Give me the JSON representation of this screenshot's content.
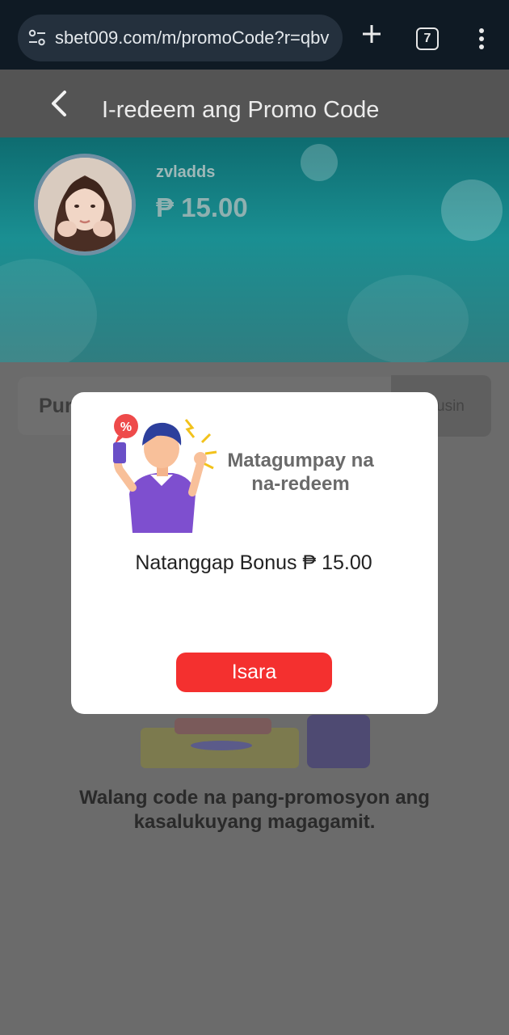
{
  "browser": {
    "url": "sbet009.com/m/promoCode?r=qbv",
    "tab_count": "7"
  },
  "header": {
    "title": "I-redeem ang Promo Code"
  },
  "profile": {
    "username": "zvladds",
    "balance": "₱ 15.00"
  },
  "promo_input": {
    "placeholder": "Pur",
    "button_label": "usin"
  },
  "empty_state": {
    "message": "Walang code na pang-promosyon ang kasalukuyang magagamit."
  },
  "dialog": {
    "title": "Matagumpay na na-redeem",
    "message": "Natanggap Bonus ₱ 15.00",
    "close_label": "Isara"
  }
}
